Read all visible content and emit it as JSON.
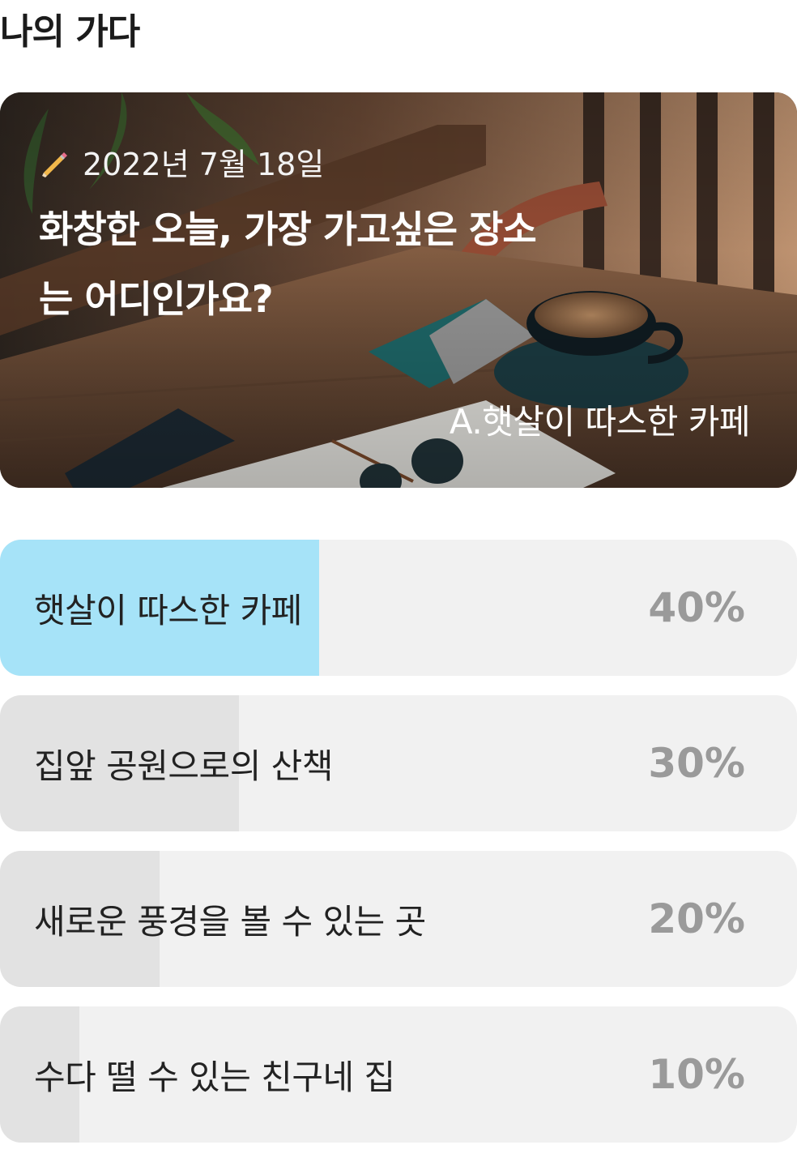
{
  "page": {
    "title": "나의 가다"
  },
  "hero": {
    "date": "2022년 7월 18일",
    "question": "화창한 오늘, 가장 가고싶은 장소는 어디인가요?",
    "selected_answer": "A.햇살이 따스한 카페",
    "icon": "pencil-icon"
  },
  "options": [
    {
      "label": "햇살이 따스한 카페",
      "percent_text": "40%",
      "percent": 40,
      "selected": true
    },
    {
      "label": "집앞 공원으로의 산책",
      "percent_text": "30%",
      "percent": 30,
      "selected": false
    },
    {
      "label": "새로운 풍경을 볼 수 있는 곳",
      "percent_text": "20%",
      "percent": 20,
      "selected": false
    },
    {
      "label": "수다 떨 수 있는 친구네 집",
      "percent_text": "10%",
      "percent": 10,
      "selected": false
    }
  ],
  "colors": {
    "selected_fill": "#a6e3f8",
    "unselected_fill": "#e2e2e2",
    "option_bg": "#f1f1f1",
    "percent_text": "#9a9a9a"
  }
}
